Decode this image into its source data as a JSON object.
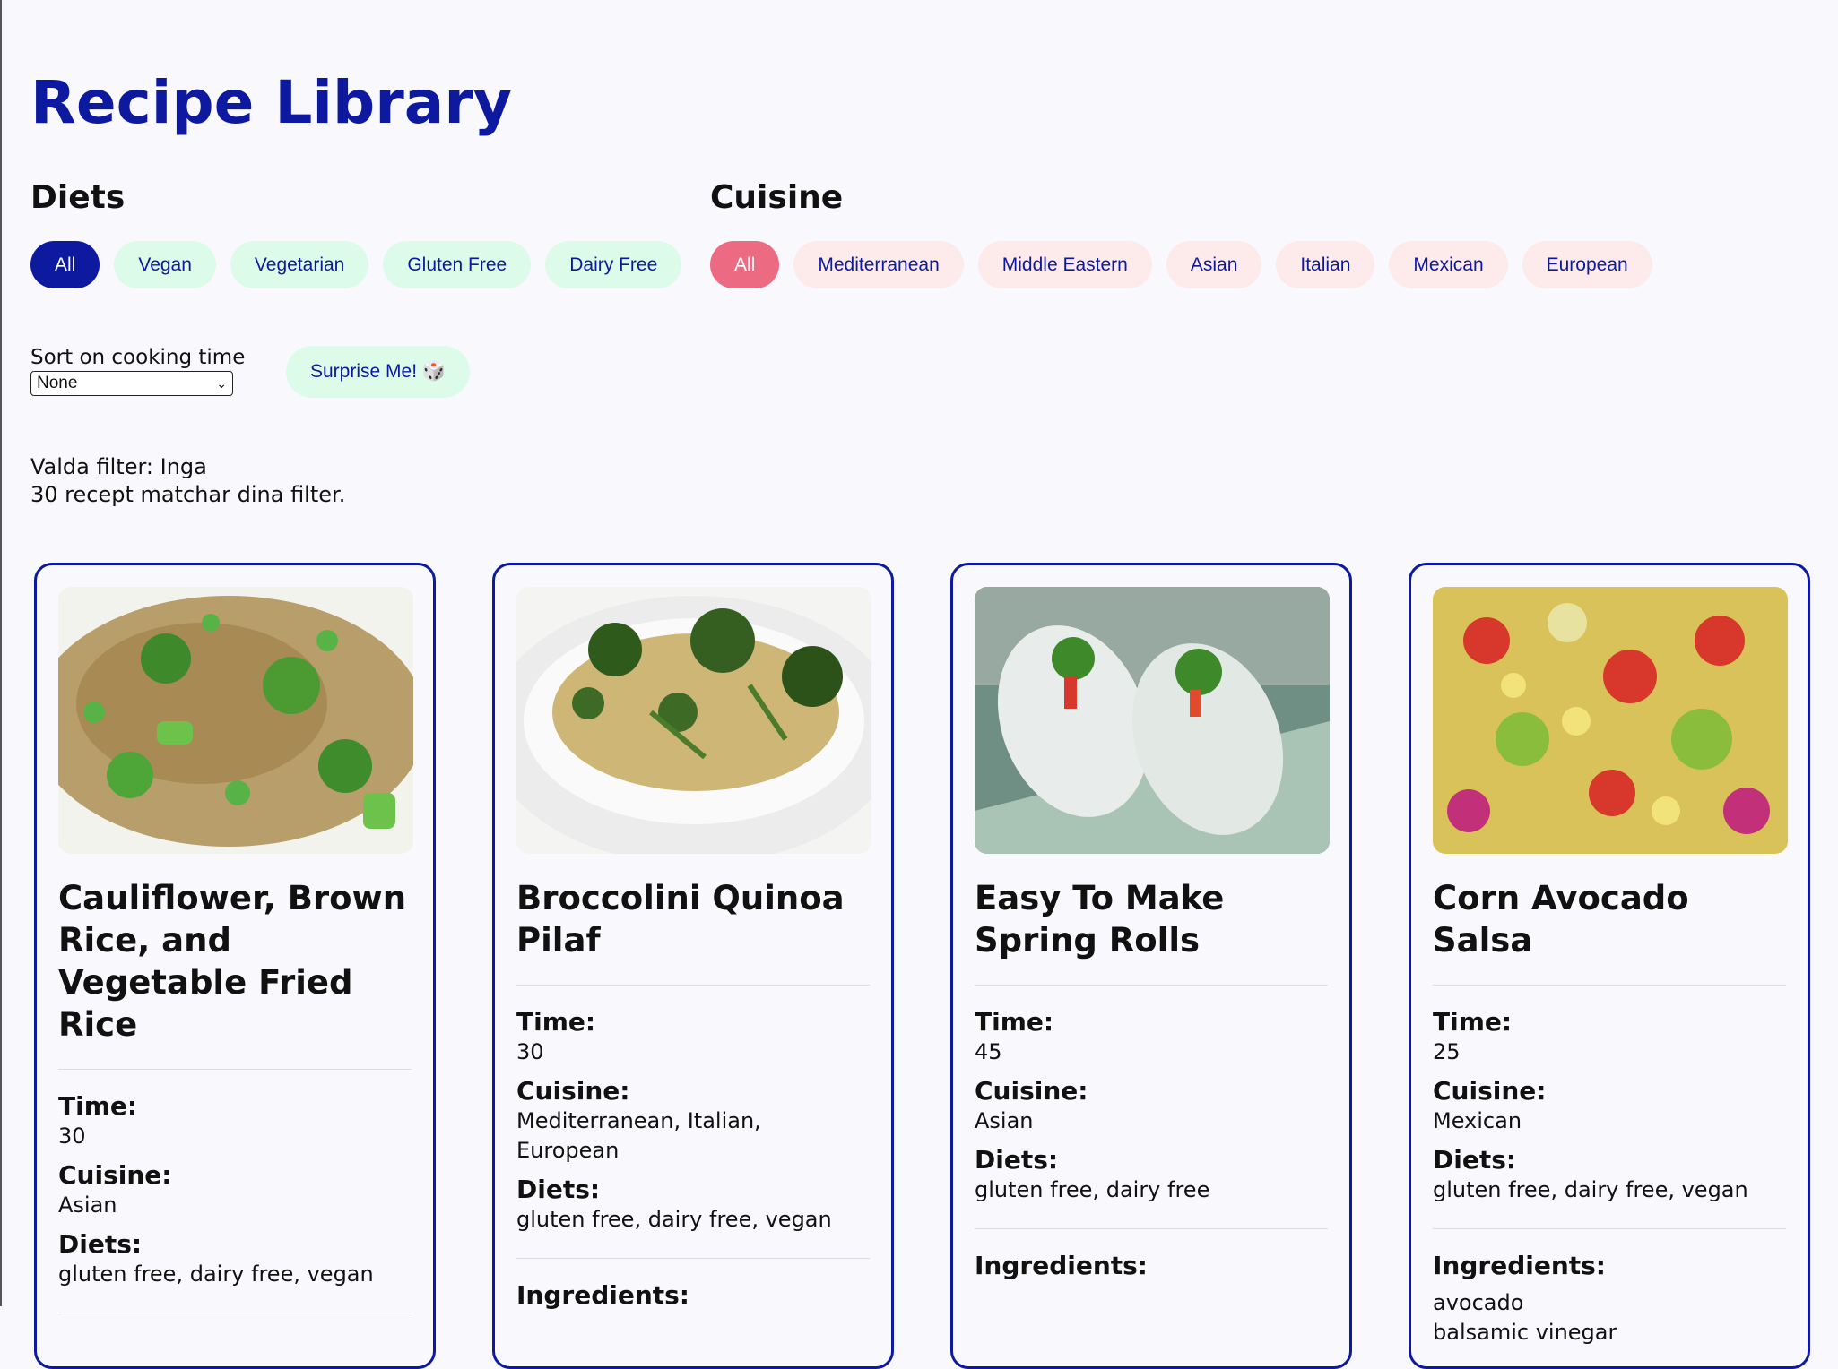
{
  "page": {
    "title": "Recipe Library"
  },
  "diets": {
    "heading": "Diets",
    "options": [
      {
        "label": "All",
        "active": true
      },
      {
        "label": "Vegan",
        "active": false
      },
      {
        "label": "Vegetarian",
        "active": false
      },
      {
        "label": "Gluten Free",
        "active": false
      },
      {
        "label": "Dairy Free",
        "active": false
      }
    ]
  },
  "cuisine": {
    "heading": "Cuisine",
    "options": [
      {
        "label": "All",
        "active": true
      },
      {
        "label": "Mediterranean",
        "active": false
      },
      {
        "label": "Middle Eastern",
        "active": false
      },
      {
        "label": "Asian",
        "active": false
      },
      {
        "label": "Italian",
        "active": false
      },
      {
        "label": "Mexican",
        "active": false
      },
      {
        "label": "European",
        "active": false
      }
    ]
  },
  "sort": {
    "label": "Sort on cooking time",
    "selected": "None"
  },
  "surprise": {
    "label": "Surprise Me! 🎲"
  },
  "status": {
    "selected_filters": "Valda filter: Inga",
    "match_count": "30 recept matchar dina filter."
  },
  "labels": {
    "time": "Time:",
    "cuisine": "Cuisine:",
    "diets": "Diets:",
    "ingredients": "Ingredients:"
  },
  "recipes": [
    {
      "title": "Cauliflower, Brown Rice, and Vegetable Fried Rice",
      "time": "30",
      "cuisine": "Asian",
      "diets": "gluten free, dairy free, vegan",
      "ingredients": []
    },
    {
      "title": "Broccolini Quinoa Pilaf",
      "time": "30",
      "cuisine": "Mediterranean, Italian, European",
      "diets": "gluten free, dairy free, vegan",
      "ingredients": []
    },
    {
      "title": "Easy To Make Spring Rolls",
      "time": "45",
      "cuisine": "Asian",
      "diets": "gluten free, dairy free",
      "ingredients": []
    },
    {
      "title": "Corn Avocado Salsa",
      "time": "25",
      "cuisine": "Mexican",
      "diets": "gluten free, dairy free, vegan",
      "ingredients": [
        "avocado",
        "balsamic vinegar"
      ]
    }
  ],
  "colors": {
    "brand": "#0d1aa0",
    "diet_chip_bg": "#dcfbe9",
    "cuisine_chip_bg": "#fdeaea",
    "cuisine_active": "#ec6b82",
    "page_bg": "#f9f9fd"
  }
}
